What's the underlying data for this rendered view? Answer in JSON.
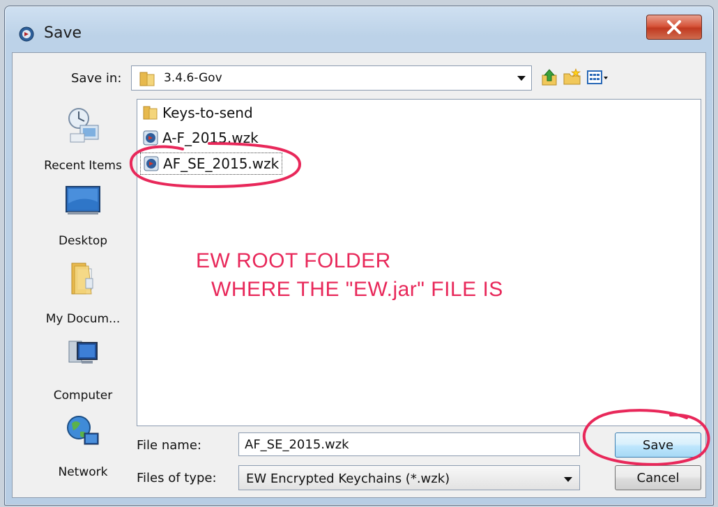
{
  "window": {
    "title": "Save",
    "close_symbol": "X"
  },
  "save_in": {
    "label": "Save in:",
    "value": "3.4.6-Gov"
  },
  "places": [
    {
      "label": "Recent Items",
      "icon": "recent-items-icon"
    },
    {
      "label": "Desktop",
      "icon": "desktop-icon"
    },
    {
      "label": "My Docum...",
      "icon": "my-documents-icon"
    },
    {
      "label": "Computer",
      "icon": "computer-icon"
    },
    {
      "label": "Network",
      "icon": "network-icon"
    }
  ],
  "files": [
    {
      "name": "Keys-to-send",
      "icon": "folder-icon"
    },
    {
      "name": "A-F_2015.wzk",
      "icon": "wzk-file-icon"
    },
    {
      "name": "AF_SE_2015.wzk",
      "icon": "wzk-file-icon"
    }
  ],
  "annotation": {
    "line1": "EW ROOT FOLDER",
    "line2": "WHERE THE \"EW.jar\" FILE IS",
    "color": "#e8285a"
  },
  "file_name": {
    "label": "File name:",
    "value": "AF_SE_2015.wzk"
  },
  "file_type": {
    "label": "Files of type:",
    "value": "EW Encrypted Keychains (*.wzk)"
  },
  "buttons": {
    "save": "Save",
    "cancel": "Cancel"
  }
}
